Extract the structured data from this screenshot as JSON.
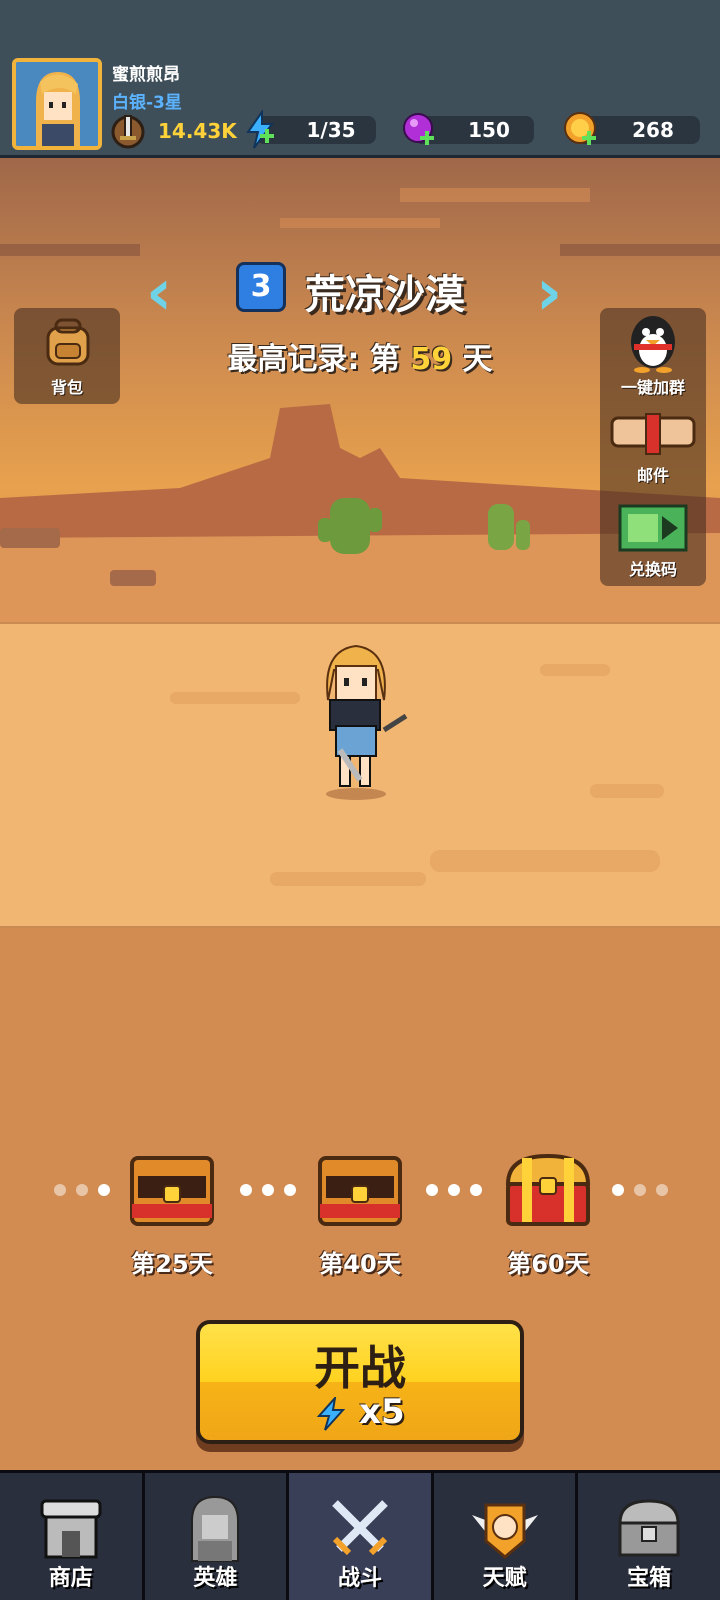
{
  "player": {
    "name": "蜜煎煎昂",
    "rank": "白银-3星",
    "power": "14.43K"
  },
  "resources": {
    "energy": "1/35",
    "gems": "150",
    "coins": "268"
  },
  "stage": {
    "number": "3",
    "name": "荒凉沙漠",
    "record_prefix": "最高记录: 第",
    "record_days": "59",
    "record_suffix": "天"
  },
  "side_buttons": {
    "backpack": "背包",
    "join_group": "一键加群",
    "mail": "邮件",
    "redeem": "兑换码"
  },
  "chests": [
    {
      "label": "第25天"
    },
    {
      "label": "第40天"
    },
    {
      "label": "第60天"
    }
  ],
  "start": {
    "label": "开战",
    "cost": "x5"
  },
  "nav": {
    "shop": "商店",
    "heroes": "英雄",
    "battle": "战斗",
    "talent": "天赋",
    "chest": "宝箱"
  },
  "colors": {
    "accent_yellow": "#ffd23a",
    "rank_blue": "#5bb3ff",
    "topbar": "#3f4f5a"
  }
}
